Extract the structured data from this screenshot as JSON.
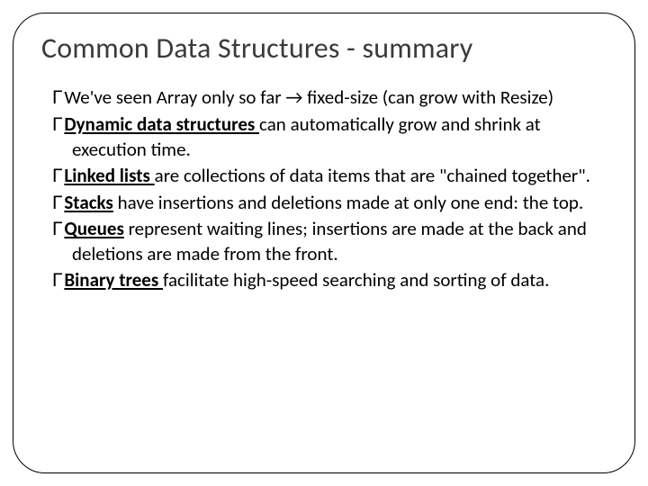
{
  "title": "Common Data Structures - summary",
  "glyph": "Г",
  "arrow": "à",
  "bullets": {
    "b0": {
      "pre": "We've seen Array only so far ",
      "arrow": "→",
      "post": " fixed-size (can grow with Resize)"
    },
    "b1": {
      "term": "Dynamic data structures ",
      "rest": "can automatically grow and shrink at execution time."
    },
    "b2": {
      "term": "Linked lists ",
      "rest": "are collections of data items that are \"chained together\"."
    },
    "b3": {
      "term": "Stacks",
      "rest": " have insertions and deletions made at only one end: the top."
    },
    "b4": {
      "term": "Queues",
      "rest": " represent waiting lines; insertions are made at the back and deletions are made from the front."
    },
    "b5": {
      "term": "Binary trees ",
      "rest": "facilitate high-speed searching and sorting of data."
    }
  }
}
